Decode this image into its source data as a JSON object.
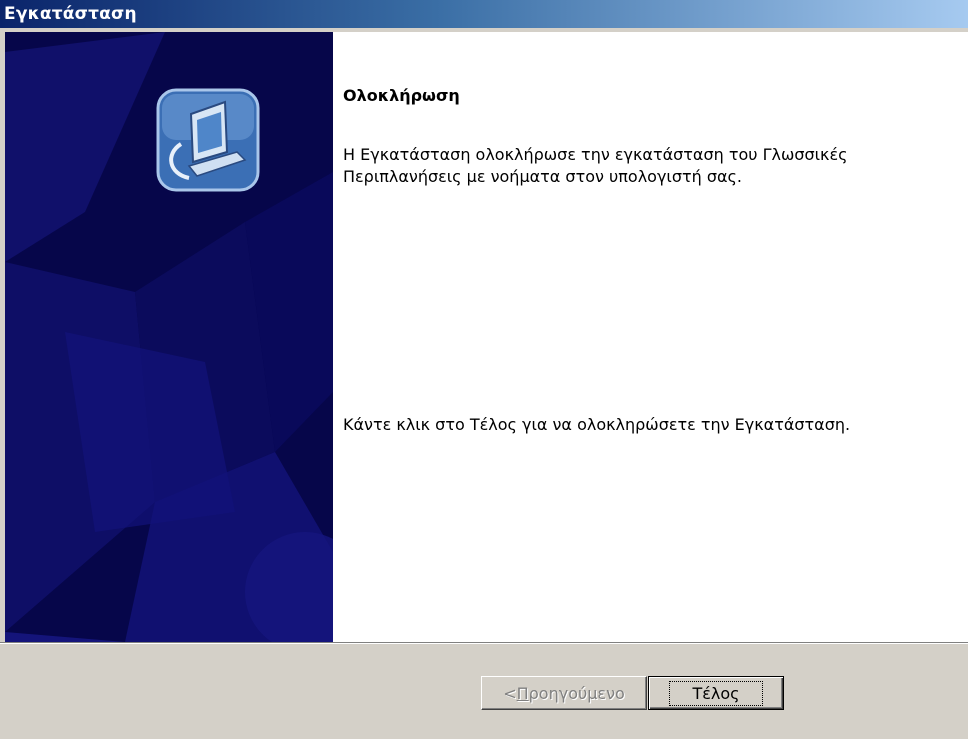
{
  "window": {
    "title": "Εγκατάσταση"
  },
  "content": {
    "heading": "Ολοκλήρωση",
    "message": "Η Εγκατάσταση ολοκλήρωσε την εγκατάσταση του Γλωσσικές Περιπλανήσεις  με νοήματα στον υπολογιστή σας.",
    "instruction": "Κάντε κλικ στο Τέλος για να ολοκληρώσετε την Εγκατάσταση."
  },
  "buttons": {
    "back_prefix": "< ",
    "back_mnemonic": "Π",
    "back_rest": "ροηγούμενο",
    "finish": "Τέλος"
  },
  "icons": {
    "setup": "computer-setup-icon"
  },
  "colors": {
    "side_panel": "#06064a",
    "titlebar_start": "#0a246a",
    "titlebar_end": "#a6caf0"
  }
}
